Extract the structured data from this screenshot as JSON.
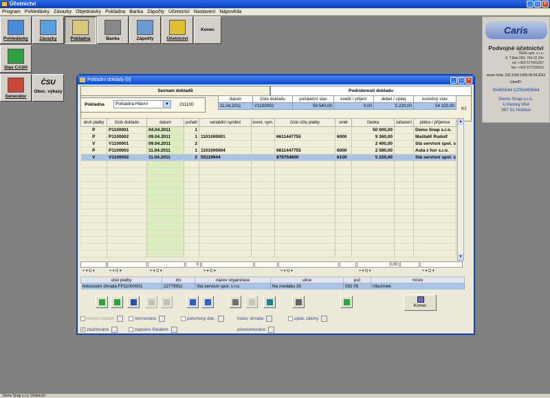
{
  "window": {
    "title": "Účetnictví"
  },
  "menu": [
    "Program",
    "Pohledávky",
    "Závazky",
    "Objednávky",
    "Pokladna",
    "Banka",
    "Zápočty",
    "Účetnictví",
    "Nastavení",
    "Nápověda"
  ],
  "toolbar": {
    "pohledavky": "Pohledávky",
    "zavazky": "Závazky",
    "pokladna": "Pokladna",
    "banka": "Banka",
    "zapocty": "Zápočty",
    "ucetnictvi": "Účetnictví",
    "konec": "Konec",
    "stav_cash": "Stav CASH",
    "generator": "Generátor",
    "csu_logo": "ČSU",
    "obec_vykazy": "Obec. výkazy"
  },
  "company_card": {
    "logo": "Caris",
    "title": "Podvojné účetnictví",
    "vendor_lines": [
      "TEAS spol. s r.o.",
      "tř. T.Bati 299, 764 22 Zlín",
      "tel: +420 577601257",
      "fax: +420 577105516"
    ],
    "version": "verze čísla: 102.1104.1003 05.04.2011",
    "user_id_label": "UserID:",
    "codes": "55465544     CZ55465544",
    "company": [
      "Demo Snap s.r.o.",
      "U Kelsky 654",
      "387 01 Hoštice"
    ]
  },
  "dialog": {
    "title": "Pokladní doklady [0]",
    "tab_list": "Seznam dokladů",
    "tab_detail": "Podrobnosti dokladu",
    "pokladna_label": "Pokladna",
    "pokladna_value": "Pokladna Hlavní",
    "pokladna_account": "211100",
    "currency_code": "Kč",
    "info_headers": [
      "datum",
      "číslo dokladu",
      "počáteční stav",
      "kredit / příjem",
      "debet / výdej",
      "konečný stav"
    ],
    "info_values": [
      "11.04.2011",
      "V1100002",
      "59 540,00",
      "0,00",
      "5 220,00",
      "54 320,00"
    ],
    "columns": [
      "druh platby",
      "číslo dokladu",
      "datum",
      "pořadí",
      "variabilní symbol",
      "konst. sym.",
      "číslo účtu platby",
      "směr",
      "částka",
      "zařazení",
      "plátce / příjemce"
    ],
    "rows": [
      {
        "druh": "P",
        "cislo": "P1100001",
        "datum": "04.04.2011",
        "poradi": "1",
        "vs": "",
        "ks": "",
        "ucet": "",
        "smer": "",
        "castka": "50 000,00",
        "zarazeni": "",
        "platce": "Demo Snap s.r.o."
      },
      {
        "druh": "P",
        "cislo": "P1100002",
        "datum": "09.04.2011",
        "poradi": "1",
        "vs": "1101000001",
        "ks": "",
        "ucet": "6611447755",
        "smer": "6000",
        "castka": "9 360,00",
        "zarazeni": "",
        "platce": "Maštalíř Rudolf"
      },
      {
        "druh": "V",
        "cislo": "V1100001",
        "datum": "09.04.2011",
        "poradi": "2",
        "vs": "",
        "ks": "",
        "ucet": "",
        "smer": "",
        "castka": "2 400,00",
        "zarazeni": "",
        "platce": "Stá servisní spol. s r.o."
      },
      {
        "druh": "P",
        "cislo": "P1100003",
        "datum": "11.04.2011",
        "poradi": "1",
        "vs": "1101000004",
        "ks": "",
        "ucet": "6611447755",
        "smer": "6000",
        "castka": "2 580,00",
        "zarazeni": "",
        "platce": "Auta z hor s.r.o."
      },
      {
        "druh": "V",
        "cislo": "V1100002",
        "datum": "11.04.2011",
        "poradi": "2",
        "vs": "55119944",
        "ks": "",
        "ucet": "879754600",
        "smer": "6100",
        "castka": "5 220,00",
        "zarazeni": "",
        "platce": "Stá servisní spol. s r.o."
      }
    ],
    "filter_date": ". .",
    "filter_poradi": "0",
    "filter_castka": "0,00",
    "sub_headers": [
      "účel platby",
      "ičo",
      "název organizace",
      "ulice",
      "psč",
      "místo"
    ],
    "sub_values": [
      "hotovostní úhrada FP11000001",
      "22779911",
      "Stá servisní spol. s r.o.",
      "Na zvedáku 35",
      "592 05",
      "Ubušínek"
    ],
    "konec_label": "Konec",
    "checks": {
      "externi": "externí doklad",
      "stornovano": "stornováno",
      "potvrzeny": "potvrzený dok.",
      "hotov_uhrada": "hotov. úhrada",
      "uplat_zalohy": "uplat. zálohy",
      "zauctovano": "zaúčtováno",
      "zapsano": "zapsáno fiskálem",
      "preckontovano": "přeckontováno"
    }
  },
  "statusbar": "Demo Snap s.r.o. Účetnictví",
  "colors": {
    "accent": "#0a3fb8",
    "date_column": "#d8eebc",
    "selection": "#a8c4e8"
  }
}
